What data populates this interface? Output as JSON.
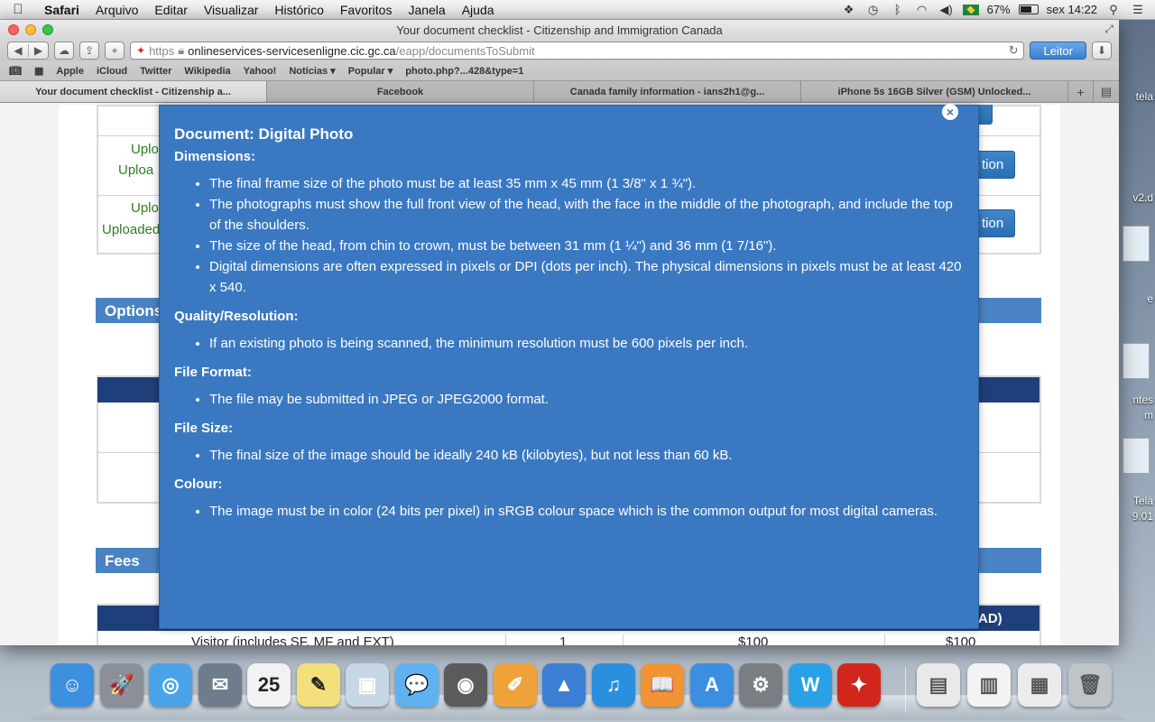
{
  "menubar": {
    "app": "Safari",
    "items": [
      "Arquivo",
      "Editar",
      "Visualizar",
      "Histórico",
      "Favoritos",
      "Janela",
      "Ajuda"
    ],
    "battery_percent": "67%",
    "battery_level": 0.67,
    "clock": "sex 14:22",
    "status_icons": [
      "dropbox-icon",
      "time-machine-icon",
      "bluetooth-icon",
      "wifi-icon",
      "volume-icon",
      "brazil-flag-icon",
      "battery-icon",
      "spotlight-icon",
      "notification-list-icon"
    ]
  },
  "window": {
    "title": "Your document checklist - Citizenship and Immigration Canada"
  },
  "toolbar": {
    "url_scheme": "https",
    "url_host": "onlineservices-servicesenligne.cic.gc.ca",
    "url_path": "/eapp/documentsToSubmit",
    "reader_label": "Leitor"
  },
  "bookmarks": [
    "Apple",
    "iCloud",
    "Twitter",
    "Wikipedia",
    "Yahoo!",
    "Notícias ▾",
    "Popular ▾",
    "photo.php?...428&type=1"
  ],
  "tabs": [
    "Your document checklist - Citizenship a...",
    "Facebook",
    "Canada family information - ians2h1@g...",
    "iPhone 5s 16GB Silver (GSM) Unlocked..."
  ],
  "background_page": {
    "rows": [
      {
        "status_line1": "Uplo",
        "status_line2": "Uploa",
        "button": "tion"
      },
      {
        "status_line1": "Uplo",
        "status_line2": "Uploaded",
        "button": "tion"
      }
    ],
    "options_heading": "Options",
    "fees_heading": "Fees",
    "fees_header_fragment": "AD)",
    "fee_row": {
      "label": "Visitor (includes SF, MF and EXT)",
      "qty": "1",
      "fee": "$100",
      "total": "$100"
    }
  },
  "modal": {
    "title": "Document: Digital Photo",
    "sections": [
      {
        "heading": "Dimensions:",
        "items": [
          "The final frame size of the photo must be at least 35 mm x 45 mm (1 3/8\" x 1 ¾\").",
          "The photographs must show the full front view of the head, with the face in the middle of the photograph, and include the top of the shoulders.",
          "The size of the head, from chin to crown, must be between 31 mm (1 ¼\") and 36 mm (1 7/16\").",
          "Digital dimensions are often expressed in pixels or DPI (dots per inch).  The physical dimensions in pixels must be at least 420 x 540."
        ]
      },
      {
        "heading": "Quality/Resolution:",
        "items": [
          "If an existing photo is being scanned, the minimum resolution must be 600 pixels per inch."
        ]
      },
      {
        "heading": "File Format:",
        "items": [
          "The file may be submitted in JPEG or JPEG2000 format."
        ]
      },
      {
        "heading": "File Size:",
        "items": [
          "The final size of the image should be ideally 240 kB (kilobytes), but not less than 60 kB."
        ]
      },
      {
        "heading": "Colour:",
        "items": [
          "The image must be in color (24 bits per pixel) in sRGB colour space which is the common output for most digital cameras."
        ]
      }
    ]
  },
  "desktop_labels": [
    "tela",
    "v2.d",
    "e",
    "ntes",
    "m",
    "Tela",
    "9.01"
  ],
  "dock": {
    "apps": [
      {
        "name": "finder-icon",
        "glyph": "☺",
        "color": "#3d8fe0"
      },
      {
        "name": "launchpad-icon",
        "glyph": "🚀",
        "color": "#8a8f98"
      },
      {
        "name": "safari-icon",
        "glyph": "◎",
        "color": "#4aa3e8"
      },
      {
        "name": "mail-icon",
        "glyph": "✉",
        "color": "#6f7c8c"
      },
      {
        "name": "calendar-icon",
        "glyph": "25",
        "color": "#f2f2f2"
      },
      {
        "name": "stickies-icon",
        "glyph": "✎",
        "color": "#f3e07a"
      },
      {
        "name": "preview-icon",
        "glyph": "▣",
        "color": "#c9d6e6"
      },
      {
        "name": "messages-icon",
        "glyph": "💬",
        "color": "#5fb2f0"
      },
      {
        "name": "facetime-icon",
        "glyph": "◉",
        "color": "#5b5b5b"
      },
      {
        "name": "pages-icon",
        "glyph": "✐",
        "color": "#f0a23a"
      },
      {
        "name": "keynote-icon",
        "glyph": "▲",
        "color": "#3a7fd4"
      },
      {
        "name": "itunes-icon",
        "glyph": "♫",
        "color": "#2b8fe0"
      },
      {
        "name": "ibooks-icon",
        "glyph": "📖",
        "color": "#f19433"
      },
      {
        "name": "app-store-icon",
        "glyph": "A",
        "color": "#3b8ee0"
      },
      {
        "name": "system-preferences-icon",
        "glyph": "⚙",
        "color": "#7a7d82"
      },
      {
        "name": "word-icon",
        "glyph": "W",
        "color": "#2aa0e6"
      },
      {
        "name": "acrobat-icon",
        "glyph": "✦",
        "color": "#d0261c"
      }
    ],
    "stacks": [
      {
        "name": "documents-stack-icon",
        "glyph": "▤",
        "color": "#e9e9e9"
      },
      {
        "name": "downloads-stack-icon",
        "glyph": "▥",
        "color": "#f3f3f3"
      },
      {
        "name": "files-stack-icon",
        "glyph": "▦",
        "color": "#ececec"
      },
      {
        "name": "trash-icon",
        "glyph": "🗑",
        "color": "#bfc4c9"
      }
    ]
  }
}
